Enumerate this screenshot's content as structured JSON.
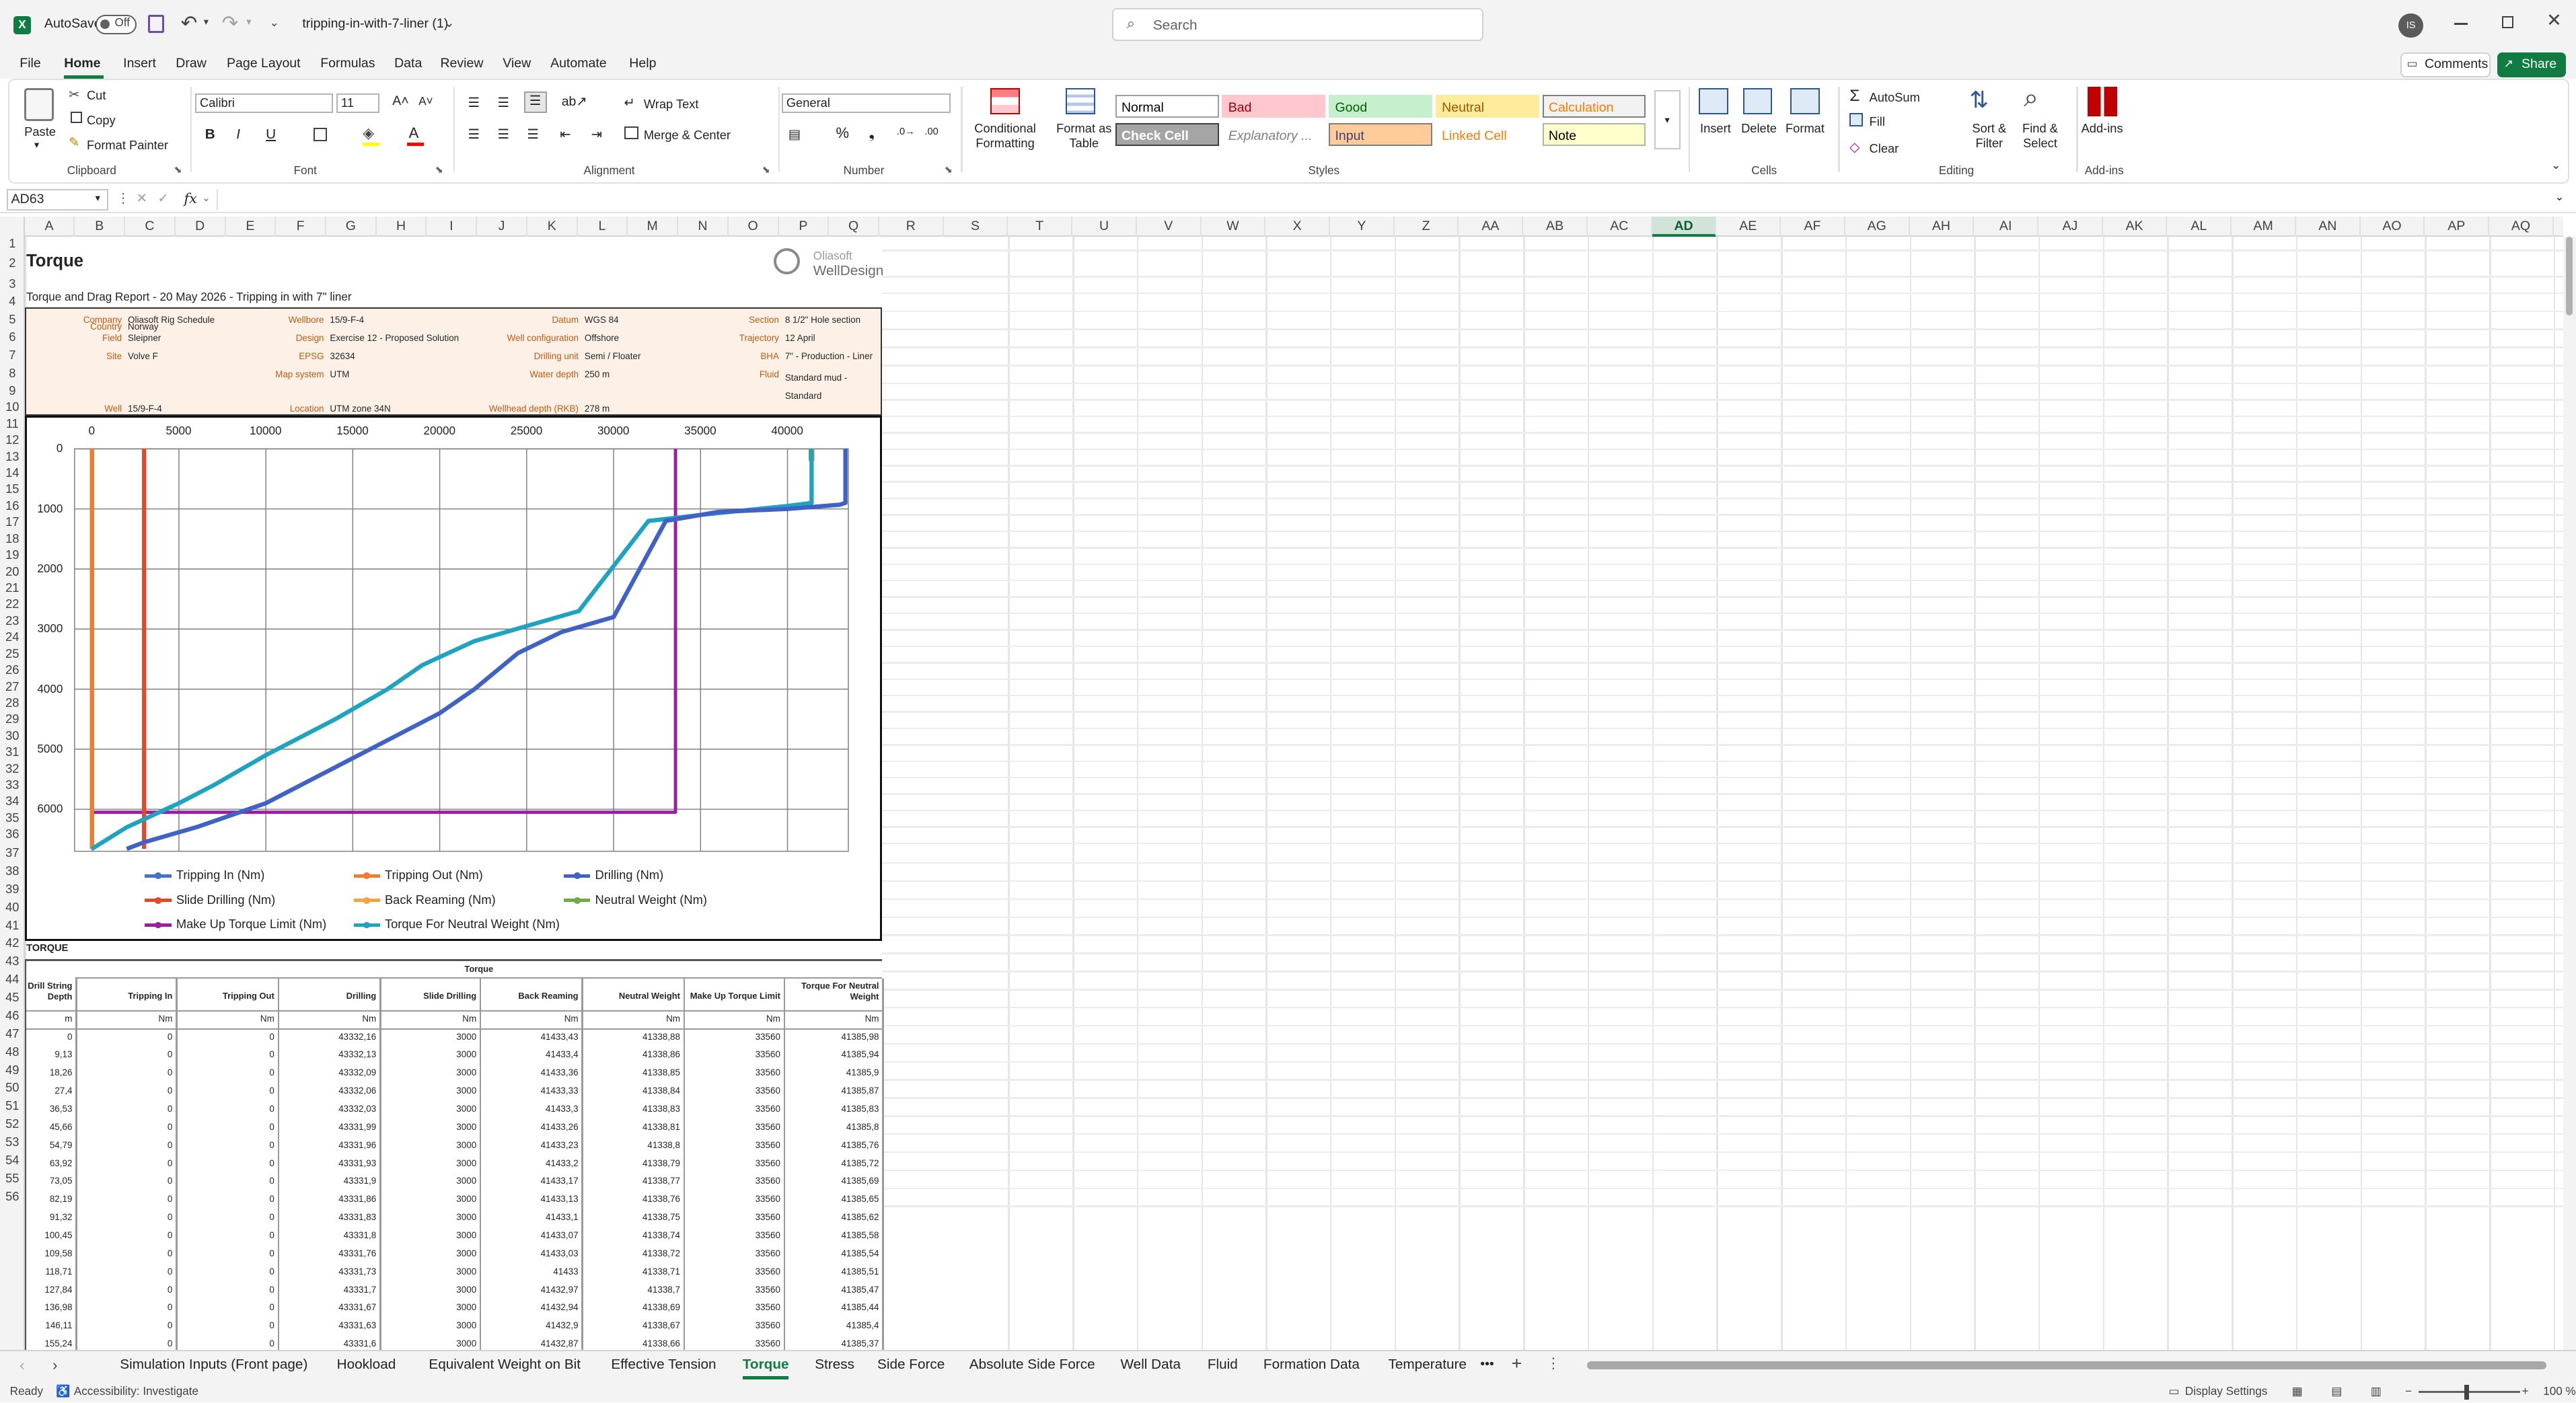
{
  "window": {
    "autosave_label": "AutoSave",
    "autosave_state": "Off",
    "filename": "tripping-in-with-7-liner (1)",
    "search_placeholder": "Search",
    "user_initials": "IS"
  },
  "menu": {
    "items": [
      "File",
      "Home",
      "Insert",
      "Draw",
      "Page Layout",
      "Formulas",
      "Data",
      "Review",
      "View",
      "Automate",
      "Help"
    ],
    "active": "Home",
    "comments": "Comments",
    "share": "Share"
  },
  "ribbon": {
    "clipboard": {
      "paste": "Paste",
      "cut": "Cut",
      "copy": "Copy",
      "format_painter": "Format Painter",
      "group": "Clipboard"
    },
    "font": {
      "name": "Calibri",
      "size": "11",
      "group": "Font",
      "bold": "B",
      "italic": "I",
      "underline": "U"
    },
    "alignment": {
      "wrap": "Wrap Text",
      "merge": "Merge & Center",
      "group": "Alignment"
    },
    "number": {
      "format": "General",
      "group": "Number"
    },
    "styles": {
      "conditional": "Conditional Formatting",
      "format_table": "Format as Table",
      "group": "Styles",
      "cells": [
        {
          "label": "Normal",
          "bg": "#ffffff",
          "fg": "#000000",
          "border": "#9e9e9e"
        },
        {
          "label": "Bad",
          "bg": "#ffc7ce",
          "fg": "#9c0006",
          "border": "#ffc7ce"
        },
        {
          "label": "Good",
          "bg": "#c6efce",
          "fg": "#006100",
          "border": "#c6efce"
        },
        {
          "label": "Neutral",
          "bg": "#ffeb9c",
          "fg": "#9c5700",
          "border": "#ffeb9c"
        },
        {
          "label": "Calculation",
          "bg": "#f2f2f2",
          "fg": "#fa7d00",
          "border": "#7f7f7f"
        },
        {
          "label": "Check Cell",
          "bg": "#a5a5a5",
          "fg": "#ffffff",
          "border": "#3f3f3f"
        },
        {
          "label": "Explanatory ...",
          "bg": "#ffffff",
          "fg": "#7f7f7f",
          "border": "#ffffff"
        },
        {
          "label": "Input",
          "bg": "#ffcc99",
          "fg": "#3f3f76",
          "border": "#7f7f7f"
        },
        {
          "label": "Linked Cell",
          "bg": "#ffffff",
          "fg": "#fa7d00",
          "border": "#ffffff"
        },
        {
          "label": "Note",
          "bg": "#ffffcc",
          "fg": "#000000",
          "border": "#b2b2b2"
        }
      ]
    },
    "cells": {
      "insert": "Insert",
      "delete": "Delete",
      "format": "Format",
      "group": "Cells"
    },
    "editing": {
      "autosum": "AutoSum",
      "fill": "Fill",
      "clear": "Clear",
      "sort": "Sort & Filter",
      "find": "Find & Select",
      "group": "Editing"
    },
    "addins": {
      "label": "Add-ins",
      "group": "Add-ins"
    }
  },
  "formula_bar": {
    "name_box": "AD63",
    "fx": "fx",
    "value": ""
  },
  "columns": [
    "A",
    "B",
    "C",
    "D",
    "E",
    "F",
    "G",
    "H",
    "I",
    "J",
    "K",
    "L",
    "M",
    "N",
    "O",
    "P",
    "Q",
    "R",
    "S",
    "T",
    "U",
    "V",
    "W",
    "X",
    "Y",
    "Z",
    "AA",
    "AB",
    "AC",
    "AD",
    "AE",
    "AF",
    "AG",
    "AH",
    "AI",
    "AJ",
    "AK",
    "AL",
    "AM",
    "AN",
    "AO",
    "AP",
    "AQ"
  ],
  "selected_column": "AD",
  "rows": [
    "1",
    "2",
    "3",
    "4",
    "5",
    "6",
    "7",
    "8",
    "9",
    "10",
    "11",
    "12",
    "13",
    "14",
    "15",
    "16",
    "17",
    "18",
    "19",
    "20",
    "21",
    "22",
    "23",
    "24",
    "25",
    "26",
    "27",
    "28",
    "29",
    "30",
    "31",
    "32",
    "33",
    "34",
    "35",
    "36",
    "37",
    "38",
    "39",
    "40",
    "41",
    "42",
    "43",
    "44",
    "45",
    "46",
    "47",
    "48",
    "49",
    "50",
    "51",
    "52",
    "53",
    "54",
    "55",
    "56"
  ],
  "report": {
    "title": "Torque",
    "subtitle": "Torque and Drag Report - 20 May 2026 - Tripping in with 7\" liner",
    "logo_line1": "Oliasoft",
    "logo_line2": "WellDesign",
    "info": [
      {
        "label": "Company",
        "value": "Oliasoft Rig Schedule"
      },
      {
        "label": "Country",
        "value": "Norway"
      },
      {
        "label": "Field",
        "value": "Sleipner"
      },
      {
        "label": "Site",
        "value": "Volve F"
      },
      {
        "label": "Well",
        "value": "15/9-F-4"
      },
      {
        "label": "Wellbore",
        "value": "15/9-F-4"
      },
      {
        "label": "Design",
        "value": "Exercise 12 - Proposed Solution"
      },
      {
        "label": "EPSG",
        "value": "32634"
      },
      {
        "label": "Map system",
        "value": "UTM"
      },
      {
        "label": "Location",
        "value": "UTM zone 34N"
      },
      {
        "label": "Datum",
        "value": "WGS 84"
      },
      {
        "label": "Well configuration",
        "value": "Offshore"
      },
      {
        "label": "Drilling unit",
        "value": "Semi / Floater"
      },
      {
        "label": "Water depth",
        "value": "250 m"
      },
      {
        "label": "Wellhead depth (RKB)",
        "value": "278 m"
      },
      {
        "label": "Section",
        "value": "8 1/2\" Hole section"
      },
      {
        "label": "Trajectory",
        "value": "12 April"
      },
      {
        "label": "BHA",
        "value": "7\" - Production - Liner"
      },
      {
        "label": "Fluid",
        "value": "Standard mud - Standard"
      }
    ]
  },
  "chart_data": {
    "type": "line",
    "title": "",
    "xlabel": "",
    "ylabel": "",
    "xlim": [
      -1000,
      43500
    ],
    "ylim": [
      6700,
      0
    ],
    "x_ticks": [
      0,
      5000,
      10000,
      15000,
      20000,
      25000,
      30000,
      35000,
      40000
    ],
    "y_ticks": [
      0,
      1000,
      2000,
      3000,
      4000,
      5000,
      6000
    ],
    "x_axis_position": "top",
    "grid": true,
    "legend_position": "bottom",
    "series": [
      {
        "name": "Tripping In (Nm)",
        "color": "#4472c4",
        "x": [
          0,
          0
        ],
        "y": [
          0,
          6660
        ]
      },
      {
        "name": "Tripping Out (Nm)",
        "color": "#ed7d31",
        "x": [
          0,
          0
        ],
        "y": [
          0,
          6660
        ]
      },
      {
        "name": "Drilling (Nm)",
        "color": "#4062c4",
        "x": [
          43332,
          43332,
          43000,
          40000,
          36000,
          33000,
          30000,
          27000,
          24500,
          22000,
          20000,
          16000,
          12000,
          10000,
          8500,
          6000,
          3000,
          2000
        ],
        "y": [
          0,
          900,
          930,
          1000,
          1050,
          1200,
          2800,
          3050,
          3400,
          4000,
          4400,
          5000,
          5600,
          5900,
          6050,
          6300,
          6550,
          6660
        ]
      },
      {
        "name": "Slide Drilling (Nm)",
        "color": "#e04a2a",
        "x": [
          3000,
          3000
        ],
        "y": [
          0,
          6660
        ]
      },
      {
        "name": "Back Reaming (Nm)",
        "color": "#f4a340",
        "x": [
          41433,
          41433
        ],
        "y": [
          0,
          200
        ]
      },
      {
        "name": "Neutral Weight (Nm)",
        "color": "#70ad47",
        "x": [
          41338,
          41338
        ],
        "y": [
          0,
          200
        ]
      },
      {
        "name": "Make Up Torque Limit (Nm)",
        "color": "#9a1fa0",
        "x": [
          33560,
          33560,
          0,
          0
        ],
        "y": [
          0,
          6050,
          6050,
          6660
        ]
      },
      {
        "name": "Torque For Neutral Weight (Nm)",
        "color": "#1ea3c0",
        "x": [
          41386,
          41386,
          40000,
          35000,
          32000,
          28000,
          25000,
          22000,
          19000,
          17000,
          14000,
          10000,
          7000,
          5000,
          2000,
          0
        ],
        "y": [
          0,
          900,
          950,
          1100,
          1200,
          2700,
          2950,
          3200,
          3600,
          4000,
          4500,
          5100,
          5600,
          5900,
          6300,
          6660
        ]
      }
    ]
  },
  "table": {
    "section_label": "TORQUE",
    "group_header": "Torque",
    "headers": [
      "Drill String Depth",
      "Tripping In",
      "Tripping Out",
      "Drilling",
      "Slide Drilling",
      "Back Reaming",
      "Neutral Weight",
      "Make Up Torque Limit",
      "Torque For Neutral Weight"
    ],
    "units": [
      "m",
      "Nm",
      "Nm",
      "Nm",
      "Nm",
      "Nm",
      "Nm",
      "Nm",
      "Nm"
    ],
    "rows": [
      [
        "0",
        "0",
        "0",
        "43332,16",
        "3000",
        "41433,43",
        "41338,88",
        "33560",
        "41385,98"
      ],
      [
        "9,13",
        "0",
        "0",
        "43332,13",
        "3000",
        "41433,4",
        "41338,86",
        "33560",
        "41385,94"
      ],
      [
        "18,26",
        "0",
        "0",
        "43332,09",
        "3000",
        "41433,36",
        "41338,85",
        "33560",
        "41385,9"
      ],
      [
        "27,4",
        "0",
        "0",
        "43332,06",
        "3000",
        "41433,33",
        "41338,84",
        "33560",
        "41385,87"
      ],
      [
        "36,53",
        "0",
        "0",
        "43332,03",
        "3000",
        "41433,3",
        "41338,83",
        "33560",
        "41385,83"
      ],
      [
        "45,66",
        "0",
        "0",
        "43331,99",
        "3000",
        "41433,26",
        "41338,81",
        "33560",
        "41385,8"
      ],
      [
        "54,79",
        "0",
        "0",
        "43331,96",
        "3000",
        "41433,23",
        "41338,8",
        "33560",
        "41385,76"
      ],
      [
        "63,92",
        "0",
        "0",
        "43331,93",
        "3000",
        "41433,2",
        "41338,79",
        "33560",
        "41385,72"
      ],
      [
        "73,05",
        "0",
        "0",
        "43331,9",
        "3000",
        "41433,17",
        "41338,77",
        "33560",
        "41385,69"
      ],
      [
        "82,19",
        "0",
        "0",
        "43331,86",
        "3000",
        "41433,13",
        "41338,76",
        "33560",
        "41385,65"
      ],
      [
        "91,32",
        "0",
        "0",
        "43331,83",
        "3000",
        "41433,1",
        "41338,75",
        "33560",
        "41385,62"
      ],
      [
        "100,45",
        "0",
        "0",
        "43331,8",
        "3000",
        "41433,07",
        "41338,74",
        "33560",
        "41385,58"
      ],
      [
        "109,58",
        "0",
        "0",
        "43331,76",
        "3000",
        "41433,03",
        "41338,72",
        "33560",
        "41385,54"
      ],
      [
        "118,71",
        "0",
        "0",
        "43331,73",
        "3000",
        "41433",
        "41338,71",
        "33560",
        "41385,51"
      ],
      [
        "127,84",
        "0",
        "0",
        "43331,7",
        "3000",
        "41432,97",
        "41338,7",
        "33560",
        "41385,47"
      ],
      [
        "136,98",
        "0",
        "0",
        "43331,67",
        "3000",
        "41432,94",
        "41338,69",
        "33560",
        "41385,44"
      ],
      [
        "146,11",
        "0",
        "0",
        "43331,63",
        "3000",
        "41432,9",
        "41338,67",
        "33560",
        "41385,4"
      ],
      [
        "155,24",
        "0",
        "0",
        "43331,6",
        "3000",
        "41432,87",
        "41338,66",
        "33560",
        "41385,37"
      ]
    ]
  },
  "sheet_tabs": [
    "Simulation Inputs (Front page)",
    "Hookload",
    "Equivalent Weight on Bit",
    "Effective Tension",
    "Torque",
    "Stress",
    "Side Force",
    "Absolute Side Force",
    "Well Data",
    "Fluid",
    "Formation Data",
    "Temperature"
  ],
  "active_tab": "Torque",
  "status": {
    "ready": "Ready",
    "accessibility": "Accessibility: Investigate",
    "display_settings": "Display Settings",
    "zoom": "100 %"
  }
}
